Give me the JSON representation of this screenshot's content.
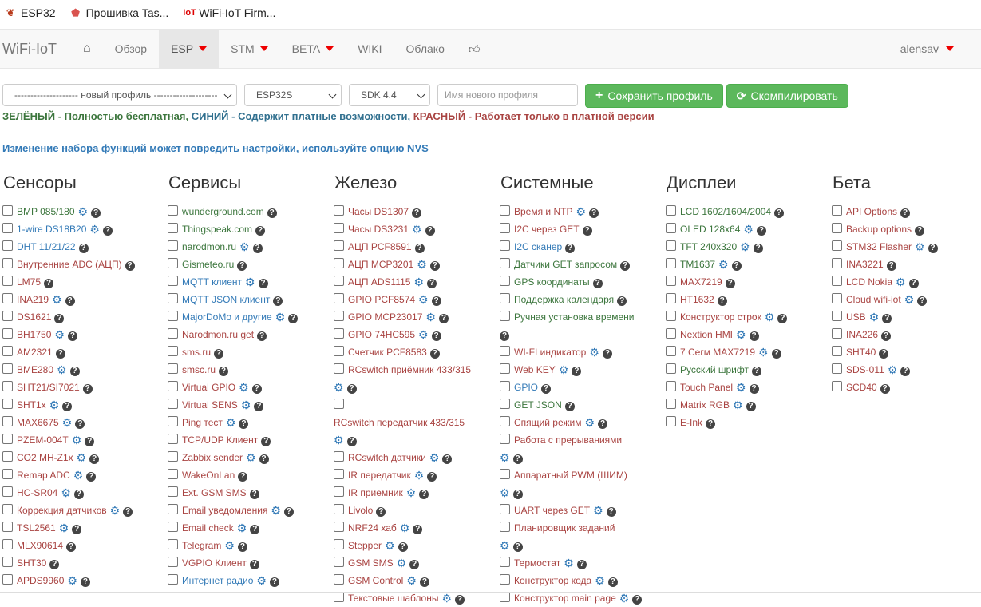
{
  "bookmarks": [
    {
      "label": "ESP32",
      "icon": "paw-icon"
    },
    {
      "label": "Прошивка Tas...",
      "icon": "tasmota-icon"
    },
    {
      "label": "WiFi-IoT Firm...",
      "icon": "iot-icon"
    }
  ],
  "navbar": {
    "brand": "WiFi-IoT",
    "items": [
      {
        "label": "",
        "icon": "home-icon"
      },
      {
        "label": "Обзор"
      },
      {
        "label": "ESP",
        "dropdown": true,
        "active": true
      },
      {
        "label": "STM",
        "dropdown": true
      },
      {
        "label": "BETA",
        "dropdown": true
      },
      {
        "label": "WIKI"
      },
      {
        "label": "Облако"
      },
      {
        "label": "",
        "icon": "thumbs-up-icon"
      }
    ],
    "user": "alensav"
  },
  "toolbar": {
    "profile_select": "-------------------- новый профиль --------------------",
    "chip_select": "ESP32S",
    "sdk_select": "SDK 4.4",
    "profile_name_placeholder": "Имя нового профиля",
    "save_label": "Сохранить профиль",
    "compile_label": "Скомпилировать"
  },
  "legend": {
    "green": "ЗЕЛЁНЫЙ - Полностью бесплатная,",
    "blue": "СИНИЙ - Содержит платные возможности,",
    "red": "КРАСНЫЙ - Работает только в платной версии"
  },
  "warning": "Изменение набора функций может повредить настройки, используйте опцию NVS",
  "colors": {
    "green": "#3c763d",
    "blue": "#337ab7",
    "red": "#a94442",
    "button": "#5cb85c"
  },
  "columns": [
    {
      "title": "Сенсоры",
      "items": [
        {
          "label": "BMP 085/180",
          "c": "g",
          "gear": true
        },
        {
          "label": "1-wire DS18B20",
          "c": "b",
          "gear": true
        },
        {
          "label": "DHT 11/21/22",
          "c": "b",
          "gear": false
        },
        {
          "label": "Внутренние ADC (АЦП)",
          "c": "r",
          "gear": false
        },
        {
          "label": "LM75",
          "c": "r",
          "gear": false
        },
        {
          "label": "INA219",
          "c": "r",
          "gear": true
        },
        {
          "label": "DS1621",
          "c": "r",
          "gear": false
        },
        {
          "label": "BH1750",
          "c": "r",
          "gear": true
        },
        {
          "label": "AM2321",
          "c": "r",
          "gear": false
        },
        {
          "label": "BME280",
          "c": "r",
          "gear": true
        },
        {
          "label": "SHT21/SI7021",
          "c": "r",
          "gear": false
        },
        {
          "label": "SHT1x",
          "c": "r",
          "gear": true
        },
        {
          "label": "MAX6675",
          "c": "r",
          "gear": true
        },
        {
          "label": "PZEM-004T",
          "c": "r",
          "gear": true
        },
        {
          "label": "CO2 MH-Z1x",
          "c": "r",
          "gear": true
        },
        {
          "label": "Remap ADC",
          "c": "r",
          "gear": true
        },
        {
          "label": "HC-SR04",
          "c": "r",
          "gear": true
        },
        {
          "label": "Коррекция датчиков",
          "c": "r",
          "gear": true
        },
        {
          "label": "TSL2561",
          "c": "r",
          "gear": true
        },
        {
          "label": "MLX90614",
          "c": "r",
          "gear": false
        },
        {
          "label": "SHT30",
          "c": "r",
          "gear": false
        },
        {
          "label": "APDS9960",
          "c": "r",
          "gear": true
        }
      ]
    },
    {
      "title": "Сервисы",
      "items": [
        {
          "label": "wunderground.com",
          "c": "g",
          "gear": false
        },
        {
          "label": "Thingspeak.com",
          "c": "g",
          "gear": false
        },
        {
          "label": "narodmon.ru",
          "c": "g",
          "gear": true
        },
        {
          "label": "Gismeteo.ru",
          "c": "g",
          "gear": false
        },
        {
          "label": "MQTT клиент",
          "c": "b",
          "gear": true
        },
        {
          "label": "MQTT JSON клиент",
          "c": "b",
          "gear": false
        },
        {
          "label": "MajorDoMo и другие",
          "c": "b",
          "gear": true
        },
        {
          "label": "Narodmon.ru get",
          "c": "r",
          "gear": false
        },
        {
          "label": "sms.ru",
          "c": "r",
          "gear": false
        },
        {
          "label": "smsc.ru",
          "c": "r",
          "gear": false
        },
        {
          "label": "Virtual GPIO",
          "c": "r",
          "gear": true
        },
        {
          "label": "Virtual SENS",
          "c": "r",
          "gear": true
        },
        {
          "label": "Ping тест",
          "c": "r",
          "gear": true
        },
        {
          "label": "TCP/UDP Клиент",
          "c": "r",
          "gear": false
        },
        {
          "label": "Zabbix sender",
          "c": "r",
          "gear": true
        },
        {
          "label": "WakeOnLan",
          "c": "r",
          "gear": false
        },
        {
          "label": "Ext. GSM SMS",
          "c": "r",
          "gear": false
        },
        {
          "label": "Email уведомления",
          "c": "r",
          "gear": true
        },
        {
          "label": "Email check",
          "c": "r",
          "gear": true
        },
        {
          "label": "Telegram",
          "c": "r",
          "gear": true
        },
        {
          "label": "VGPIO Клиент",
          "c": "r",
          "gear": false
        },
        {
          "label": "Интернет радио",
          "c": "b",
          "gear": true
        }
      ]
    },
    {
      "title": "Железо",
      "items": [
        {
          "label": "Часы DS1307",
          "c": "r",
          "gear": false
        },
        {
          "label": "Часы DS3231",
          "c": "r",
          "gear": true
        },
        {
          "label": "АЦП PCF8591",
          "c": "r",
          "gear": false
        },
        {
          "label": "АЦП MCP3201",
          "c": "r",
          "gear": true
        },
        {
          "label": "АЦП ADS1115",
          "c": "r",
          "gear": true
        },
        {
          "label": "GPIO PCF8574",
          "c": "r",
          "gear": true
        },
        {
          "label": "GPIO MCP23017",
          "c": "r",
          "gear": true
        },
        {
          "label": "GPIO 74HC595",
          "c": "r",
          "gear": true
        },
        {
          "label": "Счетчик PCF8583",
          "c": "r",
          "gear": false
        },
        {
          "label": "RCswitch приёмник 433/315",
          "c": "r",
          "gear": true,
          "wrap": true
        },
        {
          "label": "RCswitch передатчик 433/315",
          "c": "r",
          "gear": true,
          "wrap": true,
          "boxAbove": true
        },
        {
          "label": "RCswitch датчики",
          "c": "r",
          "gear": true
        },
        {
          "label": "IR передатчик",
          "c": "r",
          "gear": true
        },
        {
          "label": "IR приемник",
          "c": "r",
          "gear": true
        },
        {
          "label": "Livolo",
          "c": "r",
          "gear": false
        },
        {
          "label": "NRF24 хаб",
          "c": "r",
          "gear": true
        },
        {
          "label": "Stepper",
          "c": "r",
          "gear": true
        },
        {
          "label": "GSM SMS",
          "c": "r",
          "gear": true
        },
        {
          "label": "GSM Control",
          "c": "r",
          "gear": true
        },
        {
          "label": "Текстовые шаблоны",
          "c": "r",
          "gear": true
        }
      ]
    },
    {
      "title": "Системные",
      "items": [
        {
          "label": "Время и NTP",
          "c": "r",
          "gear": true
        },
        {
          "label": "I2C через GET",
          "c": "r",
          "gear": false
        },
        {
          "label": "I2C сканер",
          "c": "b",
          "gear": false
        },
        {
          "label": "Датчики GET запросом",
          "c": "g",
          "gear": false
        },
        {
          "label": "GPS координаты",
          "c": "g",
          "gear": false
        },
        {
          "label": "Поддержка календаря",
          "c": "g",
          "gear": false
        },
        {
          "label": "Ручная установка времени",
          "c": "g",
          "gear": false,
          "wrap": true
        },
        {
          "label": "WI-FI индикатор",
          "c": "r",
          "gear": true
        },
        {
          "label": "Web KEY",
          "c": "r",
          "gear": true
        },
        {
          "label": "GPIO",
          "c": "b",
          "gear": false
        },
        {
          "label": "GET JSON",
          "c": "g",
          "gear": false
        },
        {
          "label": "Спящий режим",
          "c": "r",
          "gear": true
        },
        {
          "label": "Работа с прерываниями",
          "c": "r",
          "gear": true,
          "wrap": true
        },
        {
          "label": "Аппаратный PWM (ШИМ)",
          "c": "r",
          "gear": true,
          "wrap": true
        },
        {
          "label": "UART через GET",
          "c": "r",
          "gear": true
        },
        {
          "label": "Планировщик заданий",
          "c": "r",
          "gear": true,
          "wrap": true
        },
        {
          "label": "Термостат",
          "c": "r",
          "gear": true
        },
        {
          "label": "Конструктор кода",
          "c": "r",
          "gear": true
        },
        {
          "label": "Конструктор main page",
          "c": "r",
          "gear": true
        }
      ]
    },
    {
      "title": "Дисплеи",
      "items": [
        {
          "label": "LCD 1602/1604/2004",
          "c": "g",
          "gear": false
        },
        {
          "label": "OLED 128x64",
          "c": "g",
          "gear": true
        },
        {
          "label": "TFT 240x320",
          "c": "g",
          "gear": true
        },
        {
          "label": "TM1637",
          "c": "g",
          "gear": true
        },
        {
          "label": "MAX7219",
          "c": "r",
          "gear": false
        },
        {
          "label": "HT1632",
          "c": "r",
          "gear": false
        },
        {
          "label": "Конструктор строк",
          "c": "r",
          "gear": true
        },
        {
          "label": "Nextion HMI",
          "c": "r",
          "gear": true
        },
        {
          "label": "7 Сегм MAX7219",
          "c": "r",
          "gear": true
        },
        {
          "label": "Русский шрифт",
          "c": "g",
          "gear": false
        },
        {
          "label": "Touch Panel",
          "c": "r",
          "gear": true
        },
        {
          "label": "Matrix RGB",
          "c": "r",
          "gear": true
        },
        {
          "label": "E-Ink",
          "c": "r",
          "gear": false
        }
      ]
    },
    {
      "title": "Бета",
      "items": [
        {
          "label": "API Options",
          "c": "r",
          "gear": false
        },
        {
          "label": "Backup options",
          "c": "r",
          "gear": false
        },
        {
          "label": "STM32 Flasher",
          "c": "r",
          "gear": true
        },
        {
          "label": "INA3221",
          "c": "r",
          "gear": false
        },
        {
          "label": "LCD Nokia",
          "c": "r",
          "gear": true
        },
        {
          "label": "Cloud wifi-iot",
          "c": "r",
          "gear": true
        },
        {
          "label": "USB",
          "c": "r",
          "gear": true
        },
        {
          "label": "INA226",
          "c": "r",
          "gear": false
        },
        {
          "label": "SHT40",
          "c": "r",
          "gear": false
        },
        {
          "label": "SDS-011",
          "c": "r",
          "gear": true
        },
        {
          "label": "SCD40",
          "c": "r",
          "gear": false
        }
      ]
    }
  ]
}
